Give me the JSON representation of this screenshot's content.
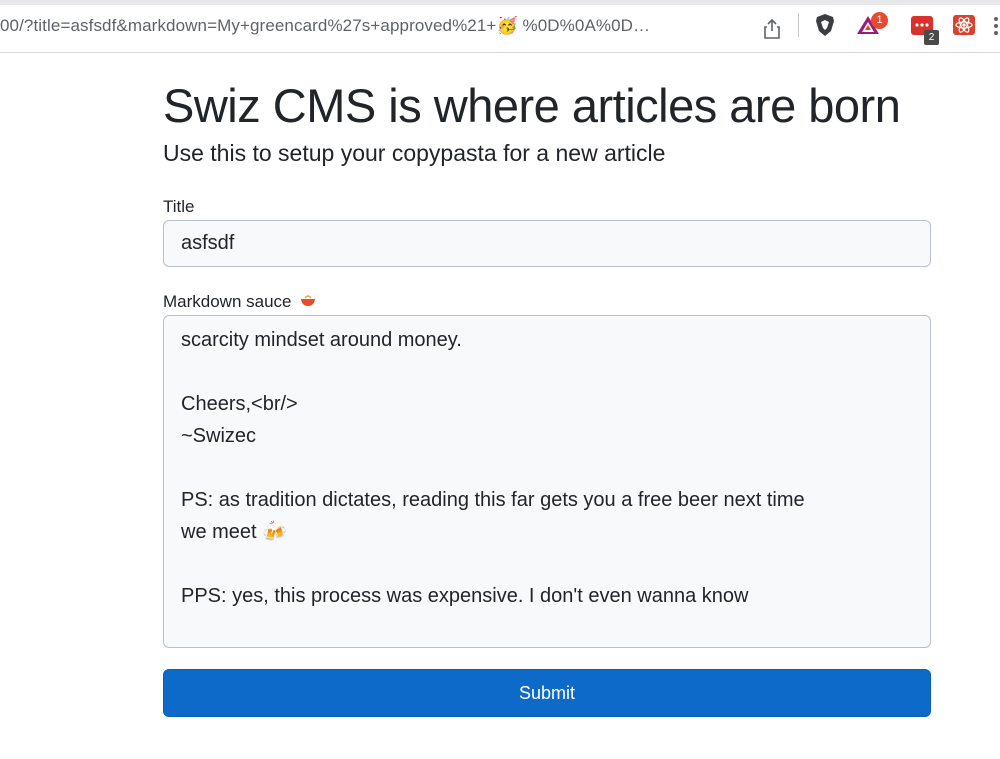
{
  "browser": {
    "url": "00/?title=asfsdf&markdown=My+greencard%27s+approved%21+🥳 %0D%0A%0D…",
    "bat_badge": "1",
    "ext_badge": "2",
    "icons": [
      "share-icon",
      "brave-shield-icon",
      "bat-rewards-icon",
      "extension-red-icon",
      "react-devtools-icon",
      "more-icon"
    ]
  },
  "page": {
    "heading": "Swiz CMS is where articles are born",
    "lead": "Use this to setup your copypasta for a new article"
  },
  "form": {
    "title_label": "Title",
    "title_value": "asfsdf",
    "markdown_label": "Markdown sauce",
    "markdown_lines": [
      "scarcity mindset around money.",
      "",
      "Cheers,<br/>",
      "~Swizec",
      "",
      "PS: as tradition dictates, reading this far gets you a free beer next time",
      "we meet 🍻",
      "",
      "PPS: yes, this process was expensive. I don't even wanna know"
    ],
    "submit_label": "Submit"
  }
}
